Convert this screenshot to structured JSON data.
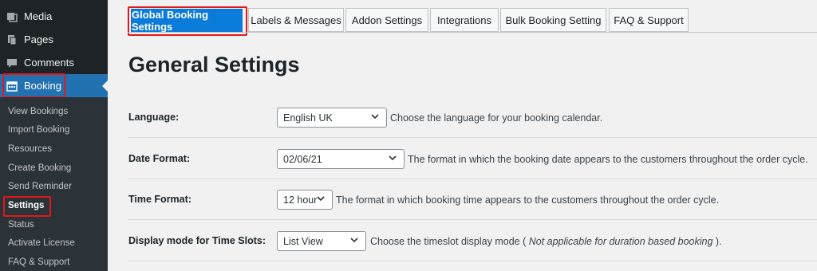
{
  "sidebar": {
    "menu": [
      {
        "label": "Media",
        "icon": "media-icon"
      },
      {
        "label": "Pages",
        "icon": "pages-icon"
      },
      {
        "label": "Comments",
        "icon": "comments-icon"
      },
      {
        "label": "Booking",
        "icon": "calendar-icon"
      }
    ],
    "submenu": [
      "View Bookings",
      "Import Booking",
      "Resources",
      "Create Booking",
      "Send Reminder",
      "Settings",
      "Status",
      "Activate License",
      "FAQ & Support"
    ]
  },
  "tabs": [
    "Global Booking Settings",
    "Labels & Messages",
    "Addon Settings",
    "Integrations",
    "Bulk Booking Setting",
    "FAQ & Support"
  ],
  "page_title": "General Settings",
  "fields": {
    "language": {
      "label": "Language:",
      "value": "English UK",
      "desc": "Choose the language for your booking calendar."
    },
    "date_format": {
      "label": "Date Format:",
      "value": "02/06/21",
      "desc": "The format in which the booking date appears to the customers throughout the order cycle."
    },
    "time_format": {
      "label": "Time Format:",
      "value": "12 hour",
      "desc": "The format in which booking time appears to the customers throughout the order cycle."
    },
    "display_mode": {
      "label": "Display mode for Time Slots:",
      "value": "List View",
      "desc_before": "Choose the timeslot display mode ( ",
      "desc_italic": "Not applicable for duration based booking",
      "desc_after": " )."
    }
  },
  "colors": {
    "accent": "#0a7bd8",
    "highlight": "#e01818",
    "sidebar": "#1d2327",
    "wp_blue": "#2271b1"
  }
}
